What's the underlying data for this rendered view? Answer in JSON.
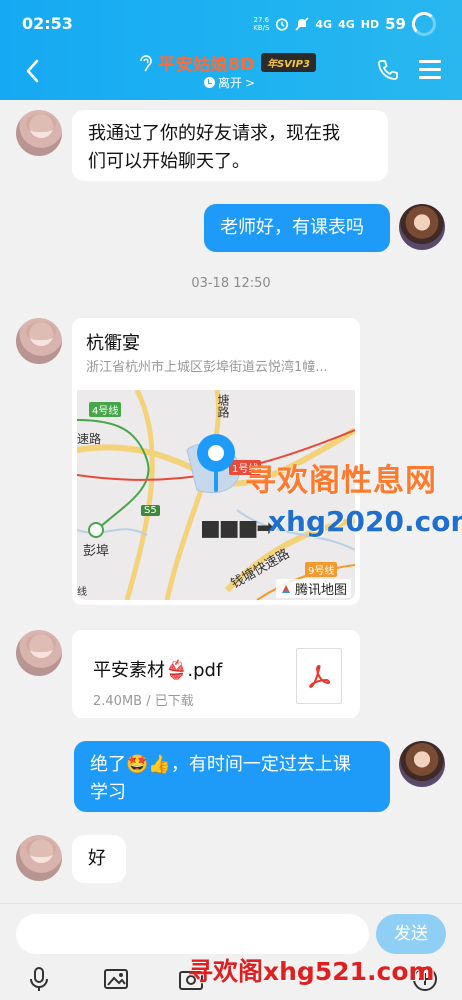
{
  "status_bar": {
    "time": "02:53",
    "net_speed_value": "27.6",
    "net_speed_unit": "KB/S",
    "signal_1": "4G",
    "signal_2": "4G",
    "hd": "HD",
    "battery": "59"
  },
  "header": {
    "contact_name": "平安姑娘8D",
    "badge": "年SVIP3",
    "status": "离开",
    "status_arrow": ">"
  },
  "messages": [
    {
      "side": "left",
      "text_line1": "我通过了你的好友请求，现在我",
      "text_line2": "们可以开始聊天了。"
    },
    {
      "side": "right",
      "text": "老师好，有课表吗"
    },
    {
      "side": "left",
      "type": "location",
      "name": "杭衢宴",
      "address": "浙江省杭州市上城区彭埠街道云悦湾1幢..."
    },
    {
      "side": "left",
      "type": "file",
      "name": "平安素材👙.pdf",
      "meta": "2.40MB / 已下载"
    },
    {
      "side": "right",
      "text_line1": "绝了🤩👍，有时间一定过去上课",
      "text_line2": "学习"
    },
    {
      "side": "left",
      "text": "好"
    }
  ],
  "timestamp": "03-18 12:50",
  "map": {
    "labels": [
      "4号线",
      "塘路",
      "速路",
      "1号线",
      "S5",
      "彭埠",
      "钱塘快速路",
      "9号线",
      "线"
    ],
    "logo": "腾讯地图"
  },
  "watermarks": {
    "line1": "寻欢阁性息网",
    "line2": "xhg2020.com",
    "arrow": "■■■➡",
    "bottom": "寻欢阁xhg521.com"
  },
  "input": {
    "send_label": "发送",
    "placeholder": ""
  },
  "colors": {
    "header_bg": "#1fb3f1",
    "bubble_self": "#1e9bf8",
    "send_button": "#8fcff5",
    "contact_name": "#ff6b35"
  },
  "icons": [
    "back-icon",
    "ear-icon",
    "phone-icon",
    "menu-icon",
    "pdf-icon",
    "mic-icon",
    "image-icon",
    "camera-icon",
    "plus-icon"
  ]
}
